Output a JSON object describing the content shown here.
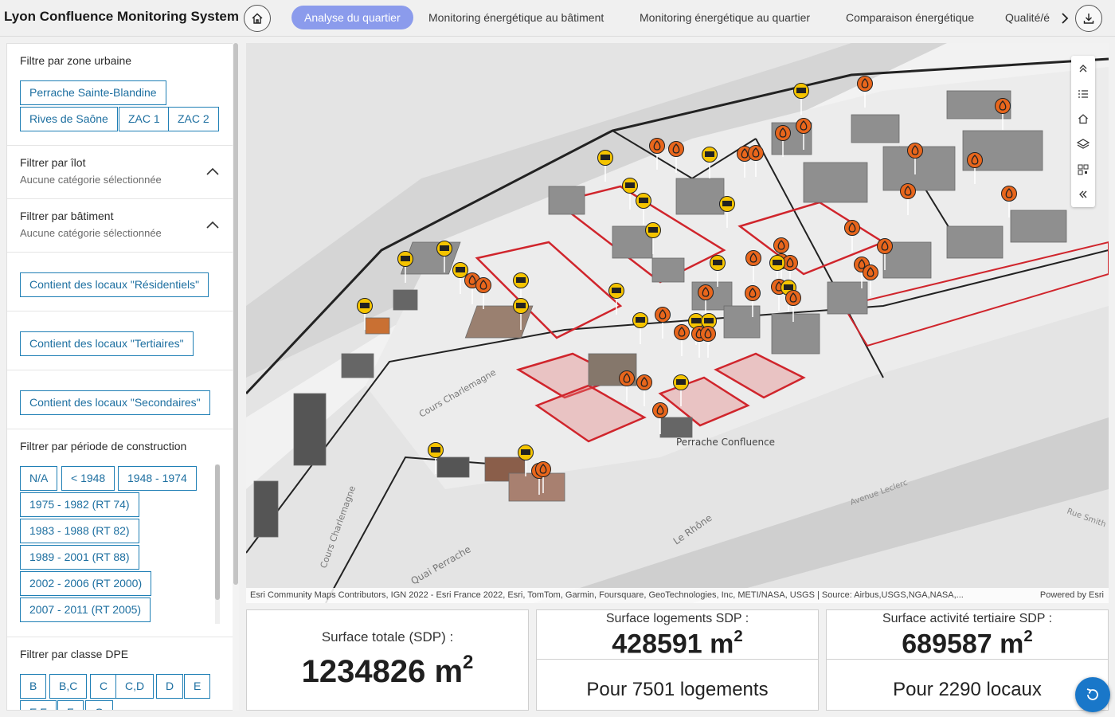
{
  "header": {
    "title": "Lyon Confluence Monitoring System",
    "tabs": [
      {
        "label": "Analyse du quartier",
        "active": true
      },
      {
        "label": "Monitoring énergétique au bâtiment",
        "active": false
      },
      {
        "label": "Monitoring énergétique au quartier",
        "active": false
      },
      {
        "label": "Comparaison énergétique",
        "active": false
      },
      {
        "label": "Qualité/é",
        "active": false
      }
    ],
    "accent_color": "#8b9bec"
  },
  "sidebar": {
    "zone": {
      "title": "Filtre par zone urbaine",
      "options": [
        "Perrache Sainte-Blandine",
        "Rives de Saône",
        "ZAC 1",
        "ZAC 2"
      ]
    },
    "ilot": {
      "title": "Filtrer par îlot",
      "subtitle": "Aucune catégorie sélectionnée"
    },
    "batiment": {
      "title": "Filtrer par bâtiment",
      "subtitle": "Aucune catégorie sélectionnée"
    },
    "locaux": [
      "Contient des locaux \"Résidentiels\"",
      "Contient des locaux \"Tertiaires\"",
      "Contient des locaux \"Secondaires\""
    ],
    "periode": {
      "title": "Filtrer par période de construction",
      "options": [
        "N/A",
        "< 1948",
        "1948 - 1974",
        "1975 - 1982 (RT 74)",
        "1983 - 1988 (RT 82)",
        "1989 - 2001 (RT 88)",
        "2002 - 2006 (RT 2000)",
        "2007 - 2011 (RT 2005)"
      ]
    },
    "dpe": {
      "title": "Filtrer par classe DPE",
      "options": [
        "B",
        "B,C",
        "C",
        "C,D",
        "D",
        "E",
        "E,F",
        "F",
        "G"
      ]
    },
    "button_color": "#1f7fb5"
  },
  "map": {
    "labels": [
      "Cours Charlemagne",
      "Cours Charlemagne",
      "Quai Perrache",
      "Perrache Confluence",
      "Le Rhône",
      "Avenue Leclerc",
      "Rue Smith"
    ],
    "attribution": "Esri Community Maps Contributors, IGN 2022 - Esri France 2022, Esri, TomTom, Garmin, Foursquare, GeoTechnologies, Inc, METI/NASA, USGS | Source: Airbus,USGS,NGA,NASA,...",
    "powered_by": "Powered by Esri",
    "tools": [
      "expand-icon",
      "legend-icon",
      "home-icon",
      "layers-icon",
      "qr-icon",
      "collapse-icon"
    ],
    "marker_colors": {
      "solar": "#f5c400",
      "heat": "#e8661c"
    }
  },
  "stats": {
    "total": {
      "label": "Surface totale (SDP) :",
      "value": "1234826 m",
      "exp": "2"
    },
    "logements": {
      "label": "Surface logements SDP :",
      "value": "428591 m",
      "exp": "2",
      "footer": "Pour 7501 logements"
    },
    "tertiaire": {
      "label": "Surface activité tertiaire SDP :",
      "value": "689587 m",
      "exp": "2",
      "footer": "Pour 2290 locaux"
    }
  }
}
